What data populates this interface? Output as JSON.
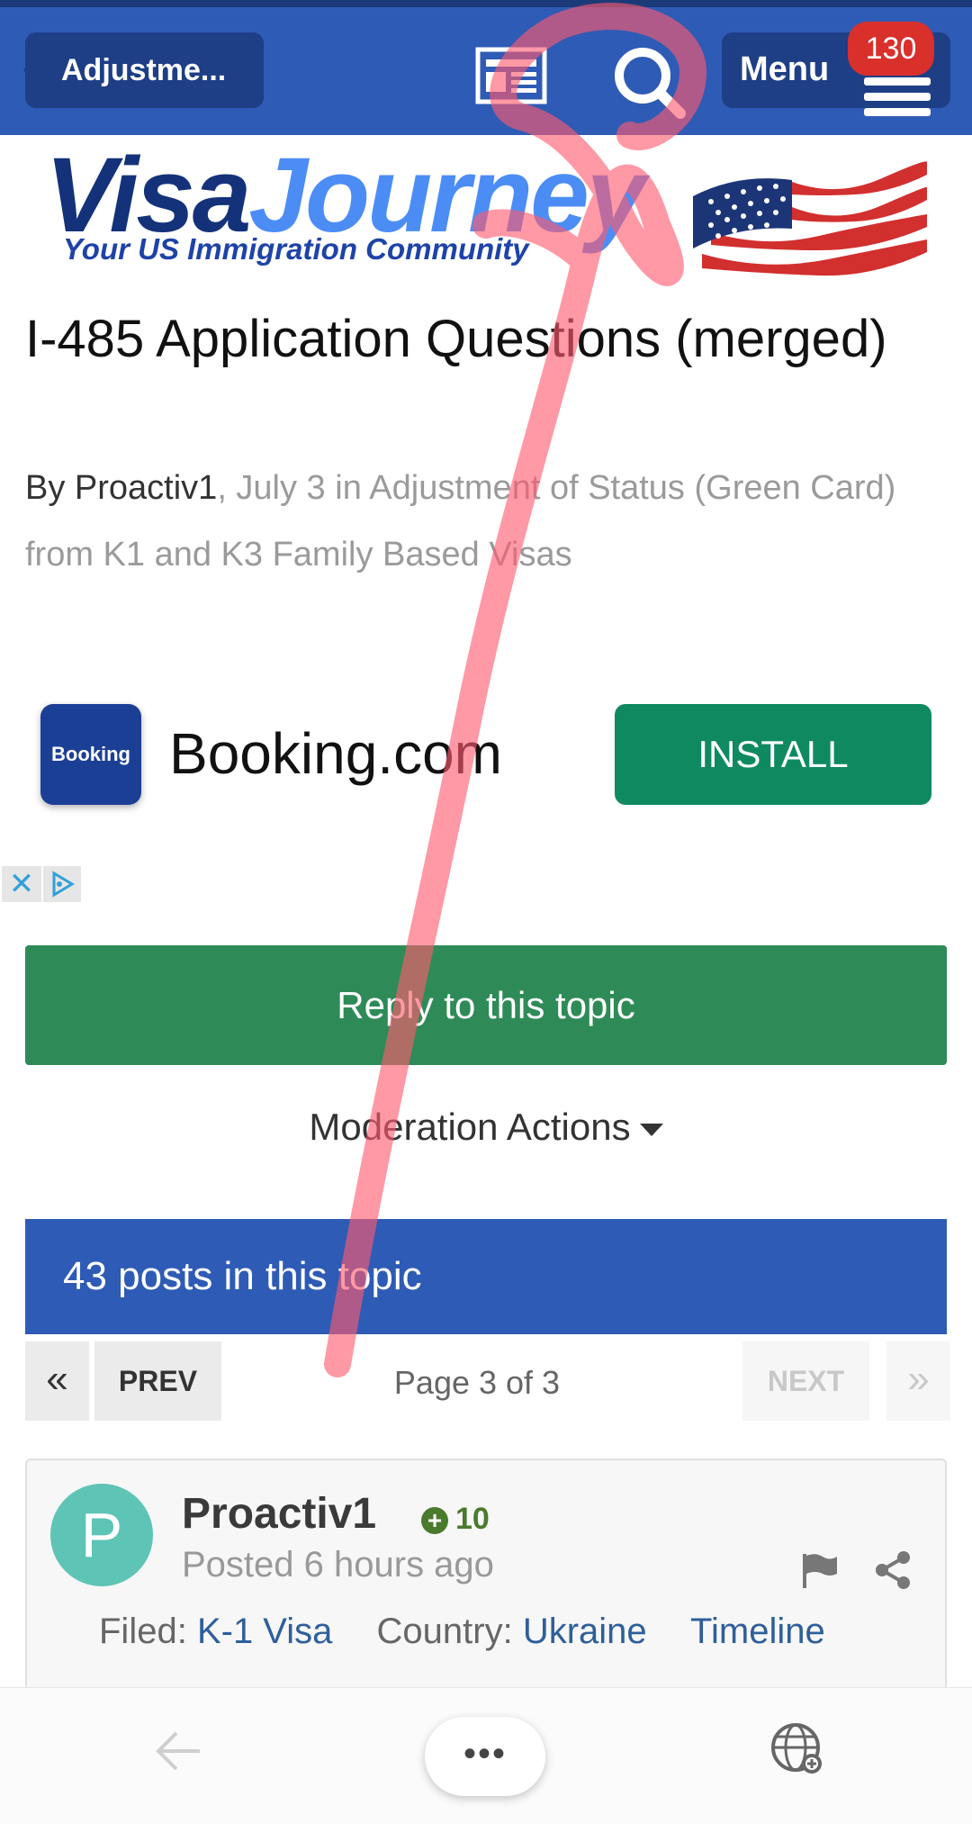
{
  "header": {
    "back_label": "Adjustme...",
    "menu_label": "Menu",
    "notification_count": "130"
  },
  "logo": {
    "word_part1": "Visa",
    "word_part2": "Journey",
    "tagline": "Your US Immigration Community"
  },
  "topic": {
    "title": "I-485 Application Questions (merged)",
    "by_prefix": "By ",
    "author": "Proactiv1",
    "meta": ", July 3 in Adjustment of Status (Green Card) from K1 and K3 Family Based Visas"
  },
  "ad": {
    "icon_text": "Booking",
    "app_name": "Booking.com",
    "install_label": "INSTALL",
    "close_glyph": "✕"
  },
  "actions": {
    "reply_label": "Reply to this topic",
    "moderation_label": "Moderation Actions"
  },
  "posts_banner": "43 posts in this topic",
  "pagination": {
    "first_glyph": "«",
    "prev_label": "PREV",
    "page_info": "Page 3 of 3",
    "next_label": "NEXT",
    "last_glyph": "»"
  },
  "post": {
    "avatar_letter": "P",
    "author": "Proactiv1",
    "reputation": "10",
    "posted": "Posted 6 hours ago",
    "filed_label": "Filed:",
    "filed_value": "K-1 Visa",
    "country_label": "Country:",
    "country_value": "Ukraine",
    "timeline_label": "Timeline"
  },
  "bottom_bar": {
    "more_glyph": "•••"
  },
  "colors": {
    "header_blue": "#2e5bb5",
    "reply_green": "#2e8b57",
    "install_green": "#0f8a60",
    "badge_red": "#d9302c",
    "annotation_pink": "#ff5a6e"
  }
}
